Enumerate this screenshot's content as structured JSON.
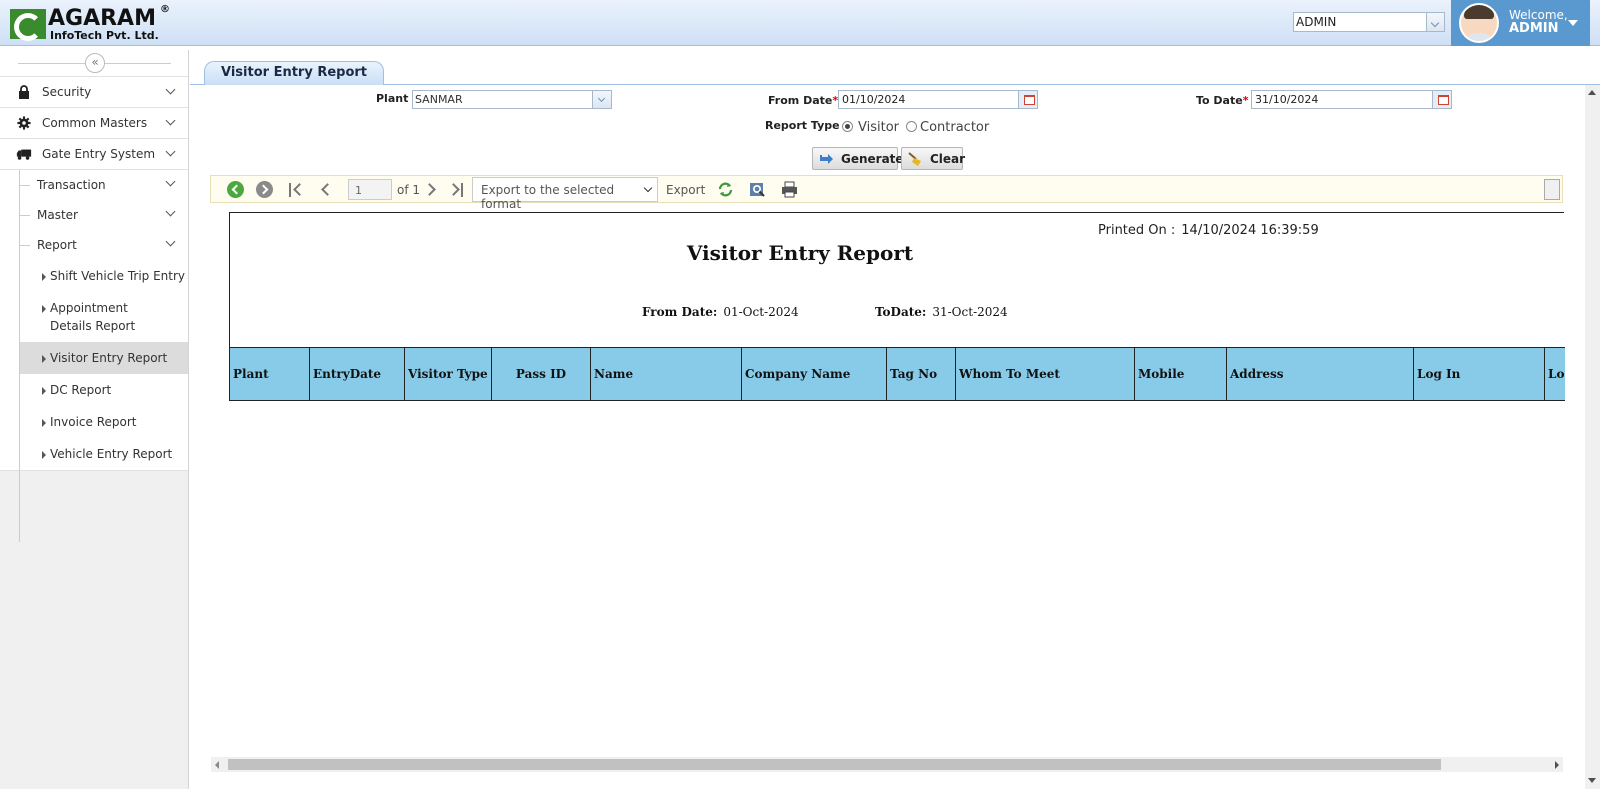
{
  "header": {
    "logo": {
      "name": "AGARAM",
      "reg": "®",
      "sub": "InfoTech Pvt. Ltd."
    },
    "user_select_value": "ADMIN",
    "welcome_label": "Welcome,",
    "welcome_name": "ADMIN"
  },
  "sidebar": {
    "collapse_glyph": "«",
    "menu": [
      {
        "label": "Security",
        "icon": "lock-icon"
      },
      {
        "label": "Common Masters",
        "icon": "gear-icon"
      },
      {
        "label": "Gate Entry System",
        "icon": "truck-icon"
      }
    ],
    "sub_items": [
      "Transaction",
      "Master",
      "Report"
    ],
    "reports": [
      "Shift Vehicle Trip Entry",
      "Appointment Details Report",
      "Visitor Entry Report",
      "DC Report",
      "Invoice Report",
      "Vehicle Entry Report"
    ],
    "active_report": "Visitor Entry Report"
  },
  "tab": {
    "label": "Visitor Entry Report"
  },
  "form": {
    "plant_label": "Plant",
    "plant_value": "SANMAR",
    "from_date_label": "From Date",
    "from_date_value": "01/10/2024",
    "to_date_label": "To Date",
    "to_date_value": "31/10/2024",
    "required_mark": "*",
    "report_type_label": "Report Type",
    "report_type_options": [
      "Visitor",
      "Contractor"
    ],
    "report_type_selected": "Visitor",
    "generate_label": "Generate",
    "clear_label": "Clear"
  },
  "toolbar": {
    "page_current": "1",
    "page_of": "of 1",
    "export_format_placeholder": "Export to the selected format",
    "export_label": "Export"
  },
  "report": {
    "printed_on_label": "Printed On :",
    "printed_on_value": "14/10/2024 16:39:59",
    "title": "Visitor Entry Report",
    "from_date_label": "From Date:",
    "from_date_value": "01-Oct-2024",
    "to_date_label": "ToDate:",
    "to_date_value": "31-Oct-2024",
    "columns": [
      "Plant",
      "EntryDate",
      "Visitor Type",
      "Pass ID",
      "Name",
      "Company Name",
      "Tag No",
      "Whom To Meet",
      "Mobile",
      "Address",
      "Log In",
      "Lo"
    ]
  },
  "colors": {
    "header_bg": "#cfe0f5",
    "welcome_bg": "#5a99cf",
    "table_header_bg": "#88cbe9",
    "toolbar_bg": "#fffdf0",
    "required": "#dd0000"
  }
}
